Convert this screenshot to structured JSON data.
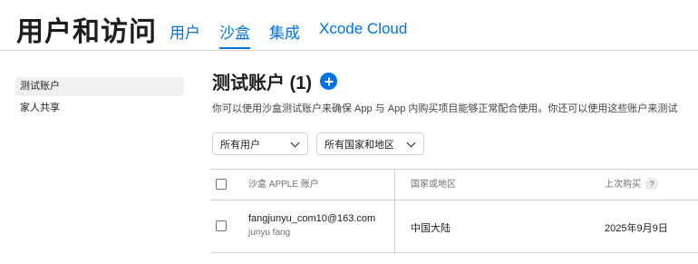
{
  "header": {
    "title": "用户和访问",
    "tabs": [
      {
        "label": "用户",
        "active": false
      },
      {
        "label": "沙盒",
        "active": true
      },
      {
        "label": "集成",
        "active": false
      },
      {
        "label": "Xcode Cloud",
        "active": false
      }
    ]
  },
  "sidebar": {
    "items": [
      {
        "label": "测试账户",
        "active": true
      },
      {
        "label": "家人共享",
        "active": false
      }
    ]
  },
  "main": {
    "title": "测试账户 (1)",
    "description": "你可以使用沙盒测试账户来确保 App 与 App 内购买项目能够正常配合使用。你还可以使用这些账户来测试",
    "filters": [
      {
        "label": "所有用户"
      },
      {
        "label": "所有国家和地区"
      }
    ],
    "table": {
      "columns": [
        "沙盒 APPLE 账户",
        "国家或地区",
        "上次购买"
      ],
      "help_glyph": "?",
      "rows": [
        {
          "email": "fangjunyu_com10@163.com",
          "name": "junyu fang",
          "region": "中国大陆",
          "last_purchase": "2025年9月9日"
        }
      ]
    }
  },
  "colors": {
    "accent": "#0071e3",
    "border": "#d2d2d7",
    "text": "#1d1d1f",
    "secondary_text": "#6e6e73"
  },
  "icons": [
    "plus-circle-icon",
    "chevron-down-icon",
    "help-icon",
    "checkbox-icon"
  ]
}
